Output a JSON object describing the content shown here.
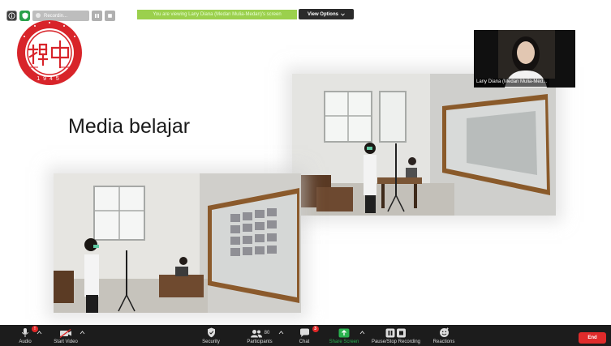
{
  "top_status": {
    "recording_label": "Recordin...",
    "logo_year": "1945"
  },
  "banner": {
    "text": "You are viewing Lany Diana (Medan Mulia-Medan)'s screen",
    "view_options": "View Options"
  },
  "slide": {
    "title": "Media belajar"
  },
  "self_view": {
    "name": "Lany Diana (Medan Mulia-Med..."
  },
  "toolbar": {
    "audio": "Audio",
    "start_video": "Start Video",
    "security": "Security",
    "participants": "Participants",
    "participants_count": "80",
    "chat": "Chat",
    "chat_badge": "3",
    "share_screen": "Share Screen",
    "pause_recording": "Pause/Stop Recording",
    "reactions": "Reactions",
    "end": "End"
  },
  "colors": {
    "toolbar_bg": "#1c1c1c",
    "banner_green": "#9bd04d",
    "share_green": "#2ab24f",
    "end_red": "#e02b2b",
    "logo_red": "#d8242a"
  }
}
